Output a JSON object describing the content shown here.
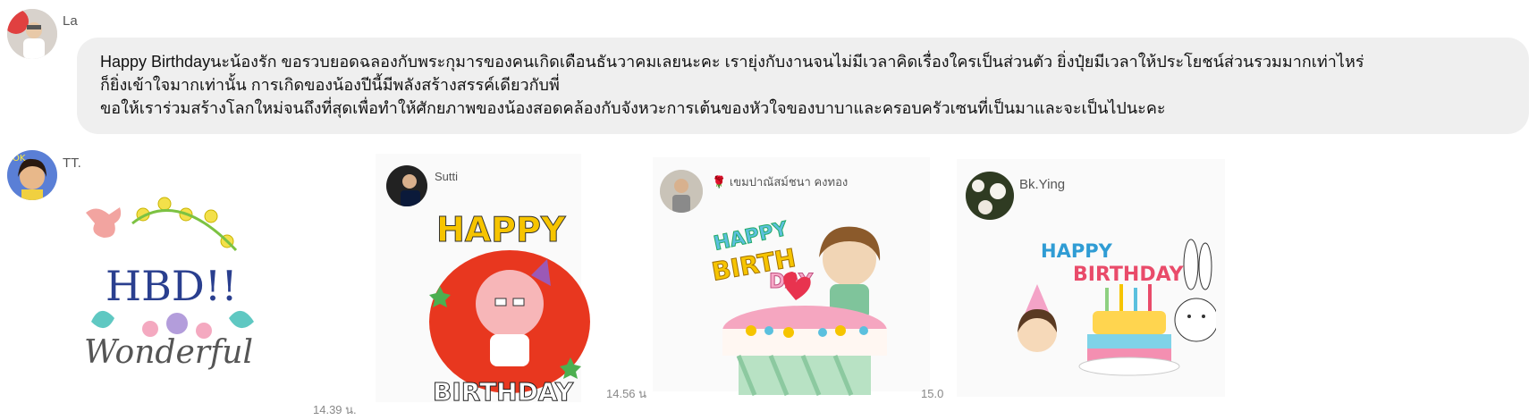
{
  "messages": [
    {
      "sender": "La",
      "avatar": "person-photo-avatar",
      "lines": [
        "Happy Birthdayนะน้องรัก ขอรวบยอดฉลองกับพระกุมารของคนเกิดเดือนธันวาคมเลยนะคะ       เรายุ่งกับงานจนไม่มีเวลาคิดเรื่องใครเป็นส่วนตัว ยิ่งปุ๋ยมีเวลาให้ประโยชน์ส่วนรวมมากเท่าไหร่",
        "ก็ยิ่งเข้าใจมากเท่านั้น การเกิดของน้องปีนี้มีพลังสร้างสรรค์เดียวกับพี่",
        "ขอให้เราร่วมสร้างโลกใหม่จนถึงที่สุดเพื่อทำให้ศักยภาพของน้องสอดคล้องกับจังหวะการเต้นของหัวใจของบาบาและครอบครัวเซนที่เป็นมาและจะเป็นไปนะคะ"
      ]
    },
    {
      "sender": "TT.",
      "sticker": {
        "title": "HBD!!",
        "subtitle": "Wonderful"
      },
      "time": "14.39 น."
    },
    {
      "sender": "Sutti",
      "sticker": {
        "top": "HAPPY",
        "bottom": "BIRTHDAY"
      },
      "time": "14.56 น"
    },
    {
      "sender": "เขมปาณัสม์ชนา คงทอง",
      "sender_emoji": "🌹",
      "sticker": {
        "line1": "HAPPY",
        "line2": "BIRTH",
        "line3": "DAY"
      },
      "time": "15.0"
    },
    {
      "sender": "Bk.Ying",
      "sticker": {
        "line1": "HAPPY",
        "line2": "BIRTHDAY"
      }
    }
  ],
  "colors": {
    "bubble": "#efefef",
    "sutti_bg": "#e8371f",
    "hbd_text": "#2a3f8f"
  }
}
